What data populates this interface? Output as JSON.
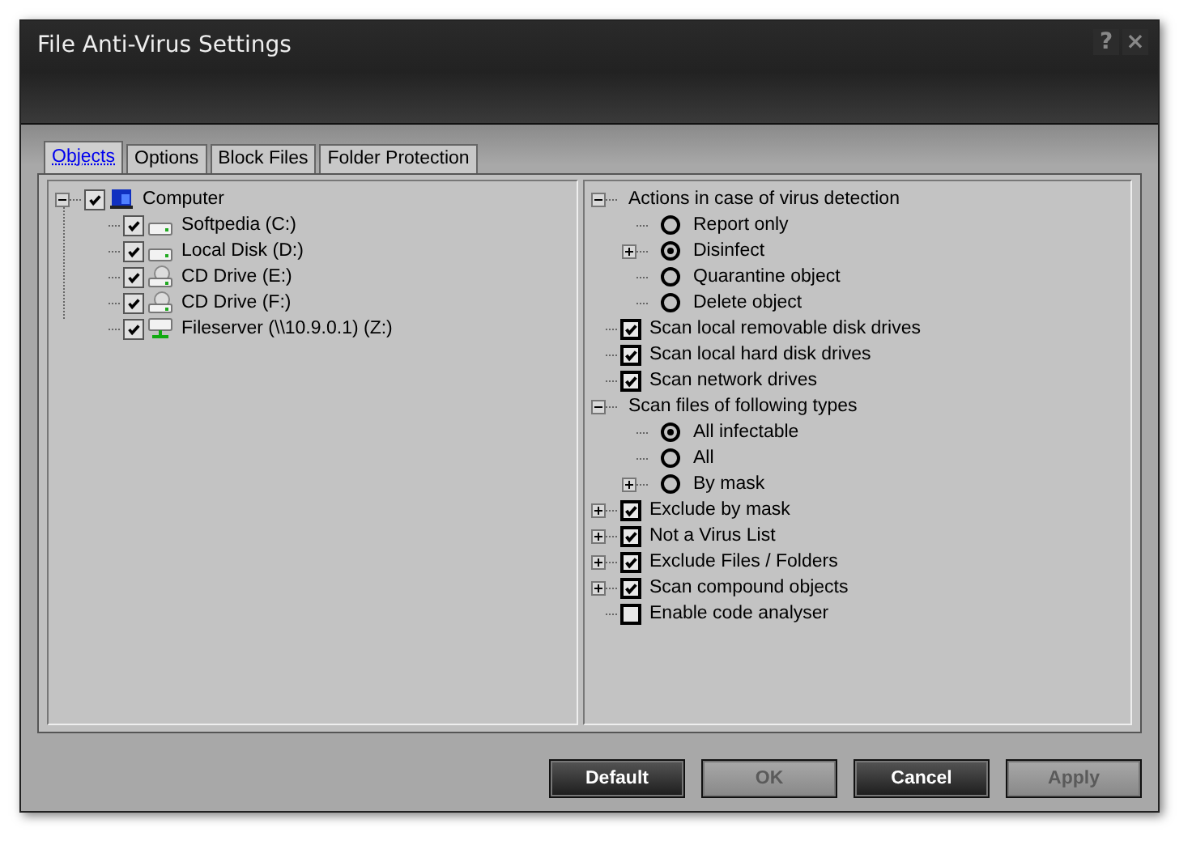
{
  "window": {
    "title": "File Anti-Virus Settings",
    "help": "?",
    "close": "×"
  },
  "tabs": [
    {
      "label": "Objects",
      "selected": true
    },
    {
      "label": "Options",
      "selected": false
    },
    {
      "label": "Block Files",
      "selected": false
    },
    {
      "label": "Folder Protection",
      "selected": false
    }
  ],
  "objects_tree": [
    {
      "label": "Computer",
      "kind": "computer",
      "checked": true,
      "expanded": true,
      "children": [
        {
          "label": "Softpedia (C:)",
          "kind": "hdd",
          "checked": true
        },
        {
          "label": "Local Disk (D:)",
          "kind": "hdd",
          "checked": true
        },
        {
          "label": "CD Drive (E:)",
          "kind": "cd",
          "checked": true
        },
        {
          "label": "CD Drive (F:)",
          "kind": "cd",
          "checked": true
        },
        {
          "label": "Fileserver (\\\\10.9.0.1) (Z:)",
          "kind": "network",
          "checked": true
        }
      ]
    }
  ],
  "settings_tree": [
    {
      "label": "Actions in case of virus detection",
      "kind": "group",
      "expanded": true,
      "children": [
        {
          "label": "Report only",
          "kind": "radio",
          "selected": false
        },
        {
          "label": "Disinfect",
          "kind": "radio",
          "selected": true,
          "expanded": false
        },
        {
          "label": "Quarantine object",
          "kind": "radio",
          "selected": false
        },
        {
          "label": "Delete object",
          "kind": "radio",
          "selected": false
        }
      ]
    },
    {
      "label": "Scan local removable disk drives",
      "kind": "checkbox",
      "checked": true
    },
    {
      "label": "Scan local hard disk drives",
      "kind": "checkbox",
      "checked": true
    },
    {
      "label": "Scan network drives",
      "kind": "checkbox",
      "checked": true
    },
    {
      "label": "Scan files of following types",
      "kind": "group",
      "expanded": true,
      "children": [
        {
          "label": "All infectable",
          "kind": "radio",
          "selected": true
        },
        {
          "label": "All",
          "kind": "radio",
          "selected": false
        },
        {
          "label": "By mask",
          "kind": "radio",
          "selected": false,
          "expanded": false
        }
      ]
    },
    {
      "label": "Exclude by mask",
      "kind": "checkbox",
      "checked": true,
      "expanded": false
    },
    {
      "label": "Not a Virus List",
      "kind": "checkbox",
      "checked": true,
      "expanded": false
    },
    {
      "label": "Exclude Files / Folders",
      "kind": "checkbox",
      "checked": true,
      "expanded": false
    },
    {
      "label": "Scan compound objects",
      "kind": "checkbox",
      "checked": true,
      "expanded": false
    },
    {
      "label": "Enable code analyser",
      "kind": "checkbox",
      "checked": false
    }
  ],
  "buttons": [
    {
      "label": "Default",
      "disabled": false
    },
    {
      "label": "OK",
      "disabled": true
    },
    {
      "label": "Cancel",
      "disabled": false
    },
    {
      "label": "Apply",
      "disabled": true
    }
  ]
}
